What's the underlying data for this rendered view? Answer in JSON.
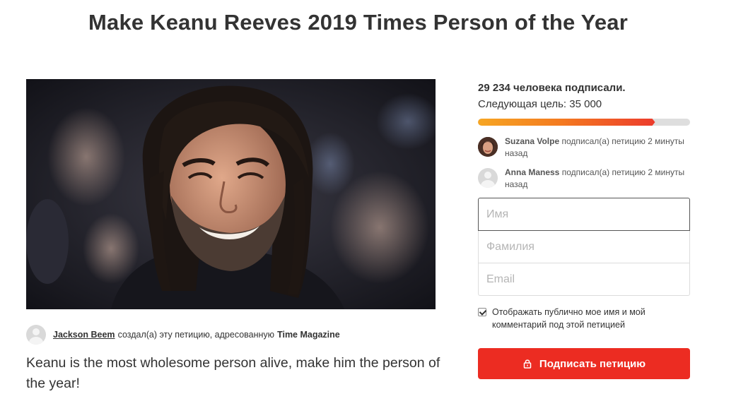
{
  "petition": {
    "title": "Make Keanu Reeves 2019 Times Person of the Year",
    "description": "Keanu is the most wholesome person alive, make him the person of the year!",
    "creator": {
      "name": "Jackson Beem",
      "text": "создал(а) эту петицию, адресованную",
      "target": "Time Magazine"
    }
  },
  "sidebar": {
    "signature_count": "29 234 человека подписали.",
    "next_goal": "Следующая цель: 35 000",
    "progress_fraction": 0.835,
    "colors": {
      "progress_start": "#f6a623",
      "progress_end": "#ec3b2c",
      "button": "#ec2c22"
    },
    "recent": [
      {
        "name": "Suzana Volpe",
        "text": "подписал(а) петицию 2 минуты назад",
        "avatar": "photo-avatar"
      },
      {
        "name": "Anna Maness",
        "text": "подписал(а) петицию 2 минуты назад",
        "avatar": "generic-user-icon"
      }
    ]
  },
  "form": {
    "first_name_placeholder": "Имя",
    "last_name_placeholder": "Фамилия",
    "email_placeholder": "Email",
    "first_name_value": "",
    "last_name_value": "",
    "email_value": "",
    "consent_label": "Отображать публично мое имя и мой комментарий под этой петицией",
    "consent_checked": true,
    "sign_button": "Подписать петицию",
    "sign_button_icon": "lock-icon"
  }
}
